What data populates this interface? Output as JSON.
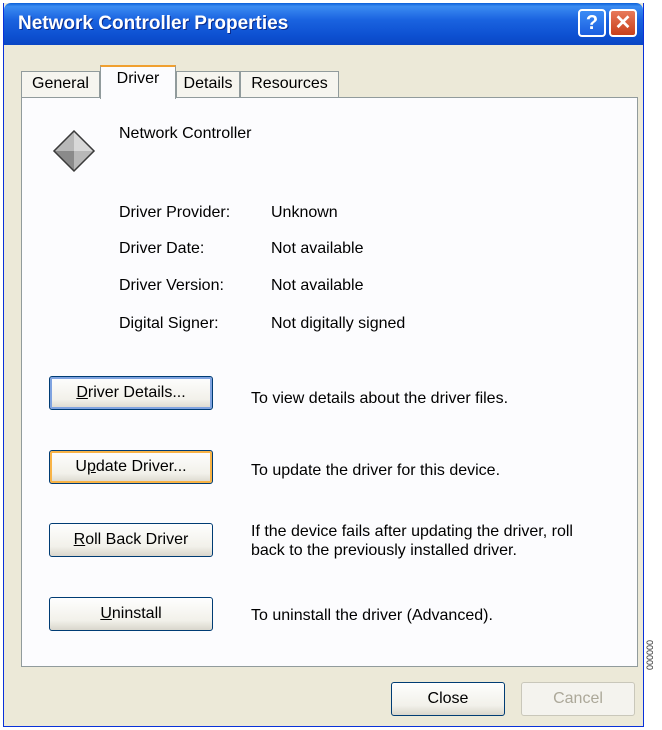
{
  "window": {
    "title": "Network Controller Properties",
    "help_label": "?",
    "close_label": "✕"
  },
  "tabs": [
    {
      "label": "General"
    },
    {
      "label": "Driver"
    },
    {
      "label": "Details"
    },
    {
      "label": "Resources"
    }
  ],
  "device": {
    "name": "Network Controller",
    "icon": "network-adapter-diamond-icon"
  },
  "info": [
    {
      "label": "Driver Provider:",
      "value": "Unknown"
    },
    {
      "label": "Driver Date:",
      "value": "Not available"
    },
    {
      "label": "Driver Version:",
      "value": "Not available"
    },
    {
      "label": "Digital Signer:",
      "value": "Not digitally signed"
    }
  ],
  "actions": {
    "driver_details": {
      "mnemonic": "D",
      "rest": "river Details...",
      "description": "To view details about the driver files."
    },
    "update_driver": {
      "pre": "U",
      "mnemonic": "p",
      "rest": "date Driver...",
      "description": "To update the driver for this device."
    },
    "roll_back": {
      "mnemonic": "R",
      "rest": "oll Back Driver",
      "description_line1": "If the device fails after updating the driver, roll",
      "description_line2": "back to the previously installed driver."
    },
    "uninstall": {
      "mnemonic": "U",
      "rest": "ninstall",
      "description": "To uninstall the driver (Advanced)."
    }
  },
  "footer": {
    "close_label": "Close",
    "cancel_label": "Cancel"
  },
  "side_code": "000000"
}
